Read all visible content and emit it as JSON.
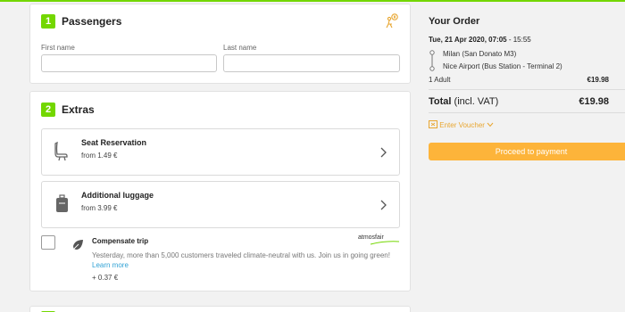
{
  "passengers": {
    "step": "1",
    "title": "Passengers",
    "first_name_label": "First name",
    "last_name_label": "Last name",
    "first_name_value": "",
    "last_name_value": ""
  },
  "extras": {
    "step": "2",
    "title": "Extras",
    "items": [
      {
        "title": "Seat Reservation",
        "price": "from 1.49 €",
        "icon": "seat-icon"
      },
      {
        "title": "Additional luggage",
        "price": "from 3.99 €",
        "icon": "luggage-icon"
      }
    ],
    "compensate": {
      "title": "Compensate trip",
      "description": "Yesterday, more than 5,000 customers traveled climate-neutral with us. Join us in going green!",
      "link": "Learn more",
      "price": "+ 0.37 €",
      "brand": "atmosfair",
      "checked": false
    }
  },
  "order": {
    "title": "Your Order",
    "date_bold": "Tue, 21 Apr 2020, 07:05",
    "date_rest": " - 15:55",
    "from": "Milan (San Donato M3)",
    "to": "Nice Airport (Bus Station - Terminal 2)",
    "adult_label": "1 Adult",
    "adult_price": "€19.98",
    "total_label": "Total",
    "total_suffix": " (incl. VAT)",
    "total_price": "€19.98",
    "voucher_label": "Enter Voucher",
    "pay_button": "Proceed to payment"
  },
  "colors": {
    "accent_green": "#73d700",
    "button_orange": "#fdb43a",
    "voucher_orange": "#e8a630",
    "link_blue": "#31a2d5"
  }
}
